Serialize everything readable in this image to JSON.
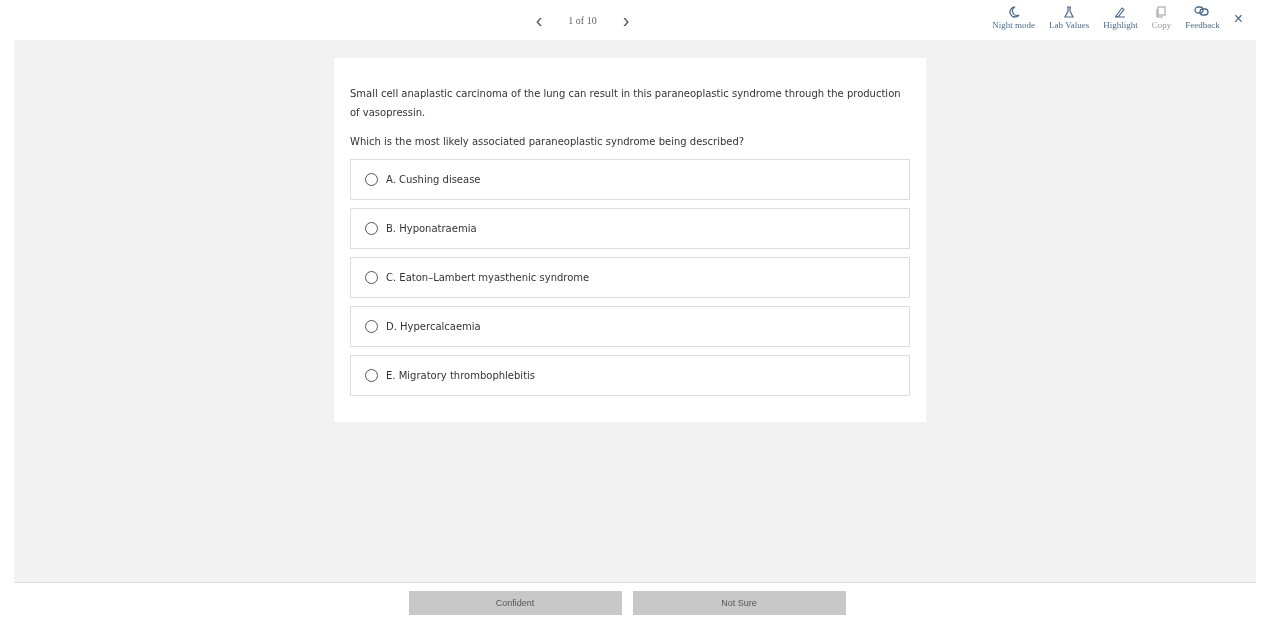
{
  "pager": {
    "prev": "‹",
    "label": "1 of 10",
    "next": "›"
  },
  "tools": [
    {
      "kind": "moon",
      "label": "Night mode",
      "disabled": false
    },
    {
      "kind": "flask",
      "label": "Lab Values",
      "disabled": false
    },
    {
      "kind": "pen",
      "label": "Highlight",
      "disabled": false
    },
    {
      "kind": "copy",
      "label": "Copy",
      "disabled": true
    },
    {
      "kind": "chat",
      "label": "Feedback",
      "disabled": false
    }
  ],
  "close": "×",
  "question": {
    "stem": "Small cell anaplastic carcinoma of the lung can result in this paraneoplastic syndrome through the production of vasopressin.",
    "prompt": "Which is the most likely associated paraneoplastic syndrome being described?",
    "options": [
      {
        "label": "A. Cushing disease",
        "selected": false
      },
      {
        "label": "B. Hyponatraemia",
        "selected": false
      },
      {
        "label": "C. Eaton–Lambert myasthenic syndrome",
        "selected": false
      },
      {
        "label": "D. Hypercalcaemia",
        "selected": false
      },
      {
        "label": "E. Migratory thrombophlebitis",
        "selected": false
      }
    ]
  },
  "buttons": [
    {
      "label": "Confident",
      "disabled": true
    },
    {
      "label": "Not Sure",
      "disabled": true
    }
  ]
}
